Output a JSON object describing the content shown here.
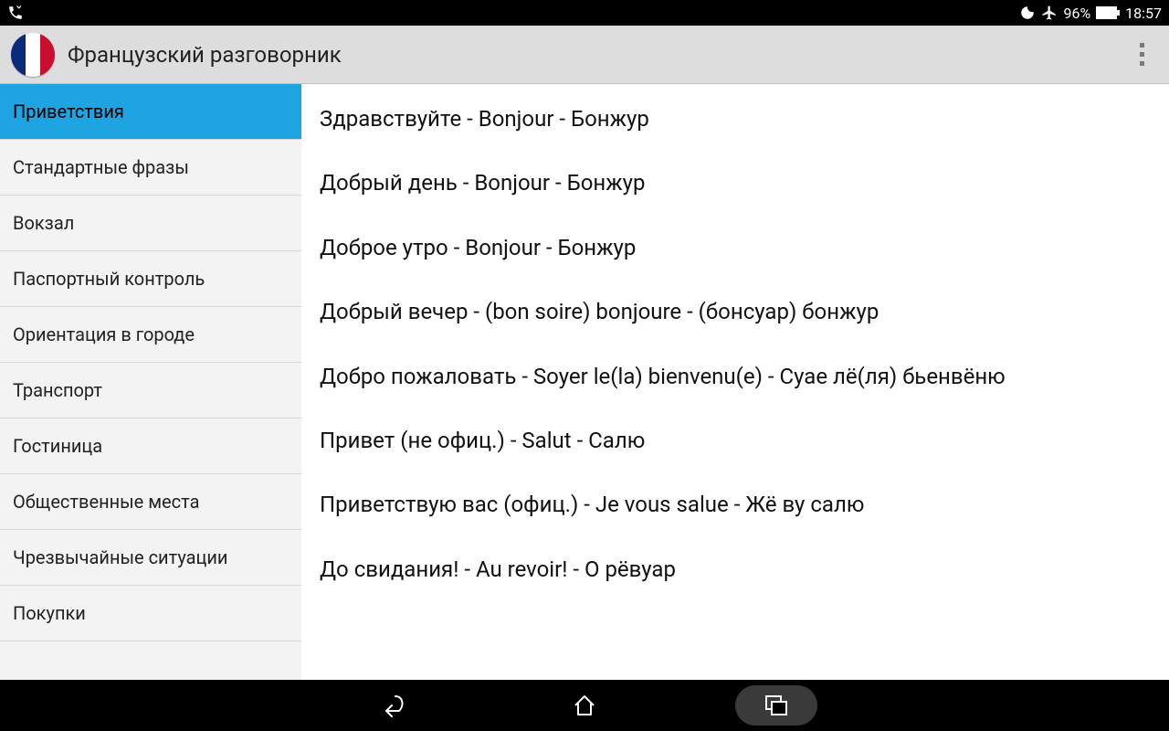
{
  "status": {
    "battery_pct": "96%",
    "time": "18:57"
  },
  "app": {
    "title": "Французский разговорник"
  },
  "sidebar": {
    "items": [
      {
        "label": "Приветствия",
        "active": true
      },
      {
        "label": "Стандартные фразы",
        "active": false
      },
      {
        "label": "Вокзал",
        "active": false
      },
      {
        "label": "Паспортный контроль",
        "active": false
      },
      {
        "label": "Ориентация в городе",
        "active": false
      },
      {
        "label": "Транспорт",
        "active": false
      },
      {
        "label": "Гостиница",
        "active": false
      },
      {
        "label": "Общественные места",
        "active": false
      },
      {
        "label": "Чрезвычайные ситуации",
        "active": false
      },
      {
        "label": "Покупки",
        "active": false
      }
    ]
  },
  "phrases": [
    "Здравствуйте - Bonjour - Бонжур",
    "Добрый день - Bonjour - Бонжур",
    "Доброе утро - Bonjour - Бонжур",
    "Добрый вечер - (bon soire) bonjoure - (бонсуар) бонжур",
    "Добро пожаловать - Soyer le(la) bienvenu(e) - Суае лё(ля) бьенвёню",
    "Привет (не офиц.) - Salut - Салю",
    "Приветствую вас (офиц.) - Je vous salue - Жё ву салю",
    "До свидания! - Au revoir! - О рёвуар"
  ]
}
